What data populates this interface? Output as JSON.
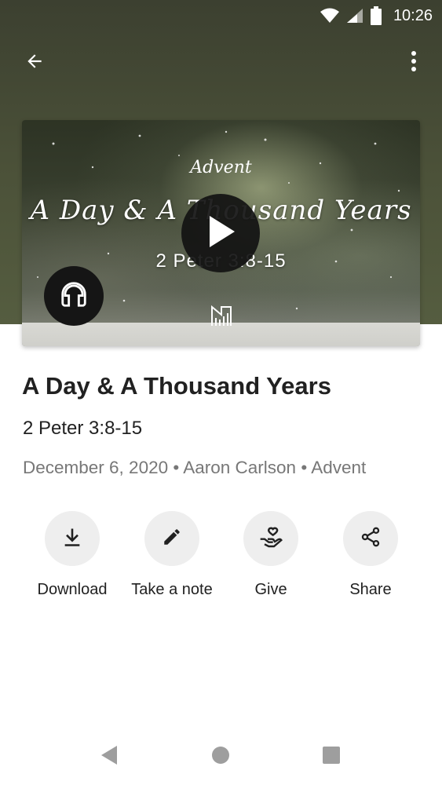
{
  "status_bar": {
    "time": "10:26",
    "icons": [
      "wifi-icon",
      "signal-icon",
      "battery-icon"
    ]
  },
  "app_bar": {
    "back_icon": "arrow-back-icon",
    "more_icon": "more-vertical-icon"
  },
  "thumbnail": {
    "series_script": "Advent",
    "title_script": "A Day & A Thousand Years",
    "scripture_ref": "2 Peter 3:8-15",
    "play_icon": "play-icon",
    "audio_icon": "headphones-icon",
    "logo_icon": "church-logo-icon"
  },
  "sermon": {
    "title": "A Day & A Thousand Years",
    "reference": "2 Peter 3:8-15",
    "meta": "December 6, 2020 • Aaron Carlson • Advent"
  },
  "actions": [
    {
      "label": "Download",
      "icon": "download-icon"
    },
    {
      "label": "Take a note",
      "icon": "pencil-icon"
    },
    {
      "label": "Give",
      "icon": "give-heart-hand-icon"
    },
    {
      "label": "Share",
      "icon": "share-icon"
    }
  ],
  "nav_bar": {
    "icons": [
      "nav-back-icon",
      "nav-home-icon",
      "nav-recents-icon"
    ]
  },
  "colors": {
    "header_bg": "#4c5239",
    "text_primary": "#212121",
    "text_secondary": "#777777",
    "action_circle": "#eeeeee",
    "nav_icon": "#9e9e9e"
  }
}
